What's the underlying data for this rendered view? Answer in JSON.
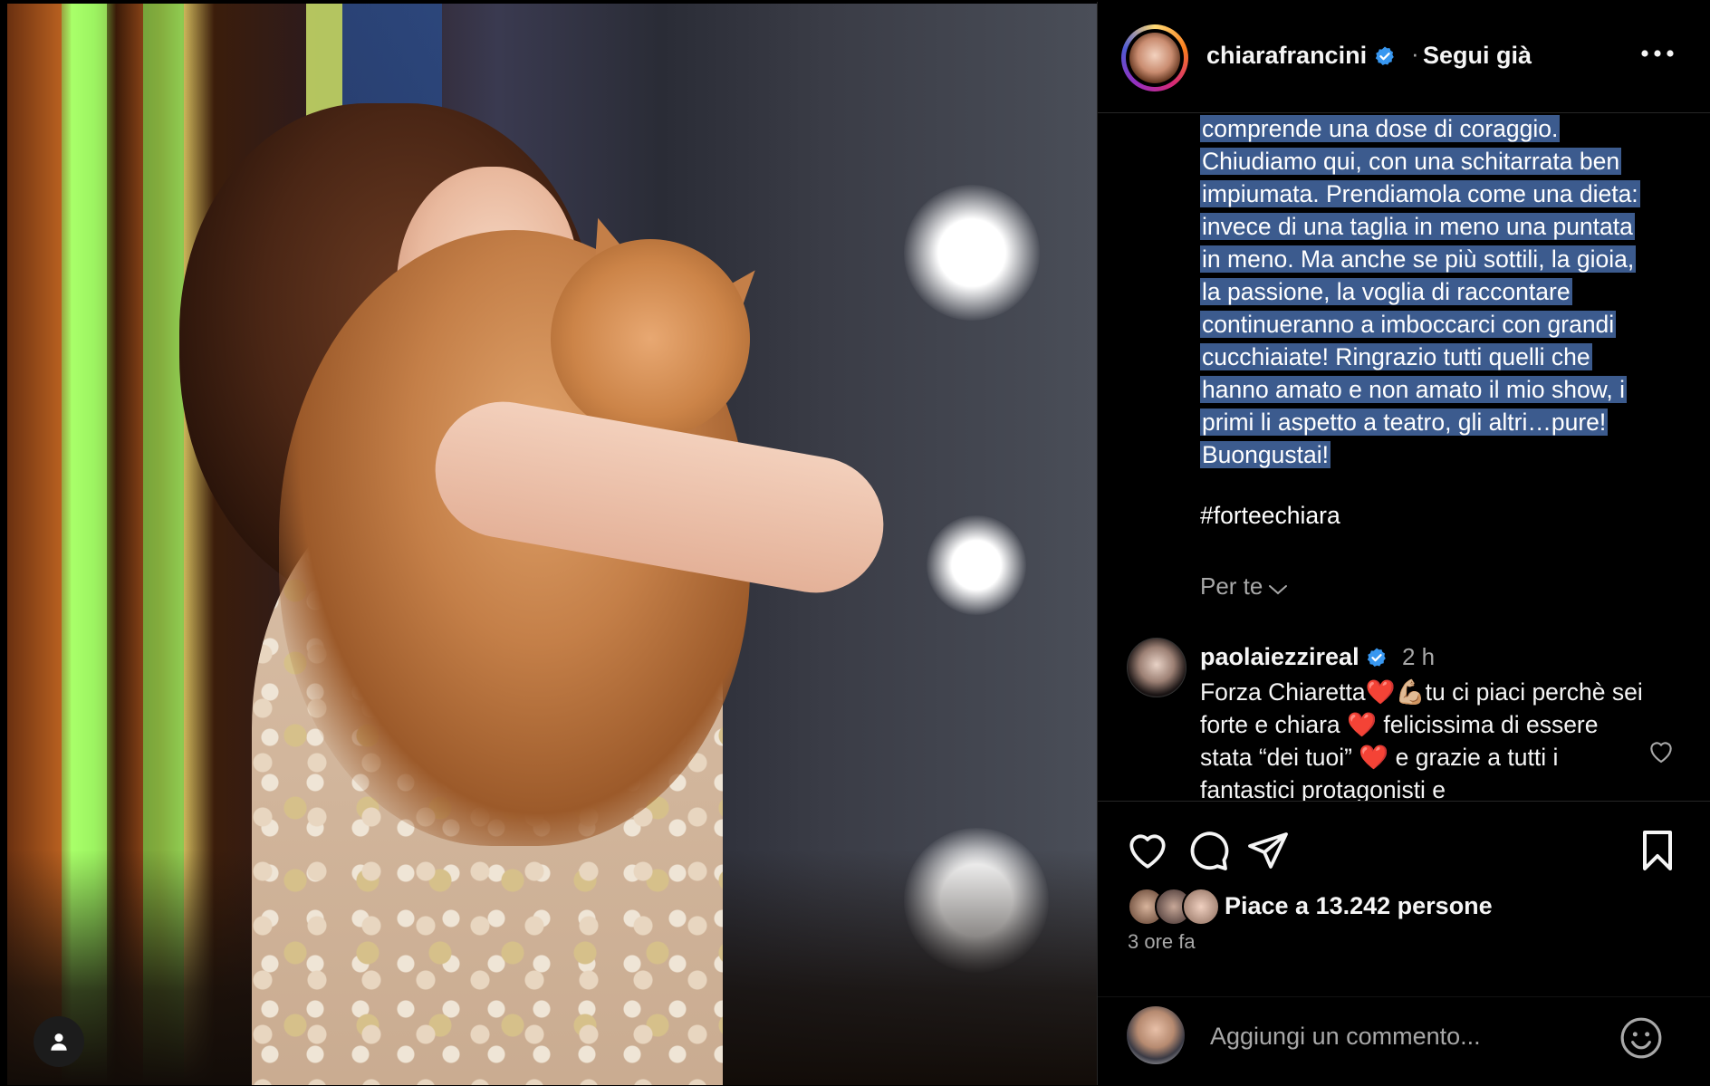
{
  "post": {
    "username": "chiarafrancini",
    "follow_separator": "·",
    "follow_label": "Segui già",
    "caption_lines": [
      "comprende una dose di coraggio.",
      "Chiudiamo qui, con una schitarrata ben",
      "impiumata. Prendiamola come una dieta:",
      "invece di una taglia in meno una puntata",
      "in meno. Ma anche se più sottili, la gioia,",
      "la passione, la voglia di raccontare",
      "continueranno a imboccarci con grandi",
      "cucchiaiate! Ringrazio tutti quelli che",
      "hanno amato e non amato il mio show, i",
      "primi li aspetto a teatro, gli altri…pure!",
      "Buongustai!"
    ],
    "hashtag": "#forteechiara",
    "for_you_label": "Per te"
  },
  "comment": {
    "username": "paolaiezzireal",
    "time": "2 h",
    "text": "Forza Chiaretta❤️💪🏼tu ci piaci perchè sei forte e chiara ❤️ felicissima di essere stata “dei tuoi” ❤️ e grazie a tutti i fantastici protagonisti e"
  },
  "stats": {
    "likes_text": "Piace a 13.242 persone",
    "time_ago": "3 ore fa"
  },
  "composer": {
    "placeholder": "Aggiungi un commento..."
  },
  "icons": {
    "more": "more-horizontal-icon",
    "like": "heart-icon",
    "comment": "comment-bubble-icon",
    "share": "paper-plane-icon",
    "save": "bookmark-icon",
    "emoji": "smiley-icon",
    "verified": "verified-badge-icon"
  },
  "colors": {
    "background": "#000000",
    "selection": "#3c5b8e",
    "verified": "#3897f0",
    "muted_text": "#a8a8a8"
  }
}
